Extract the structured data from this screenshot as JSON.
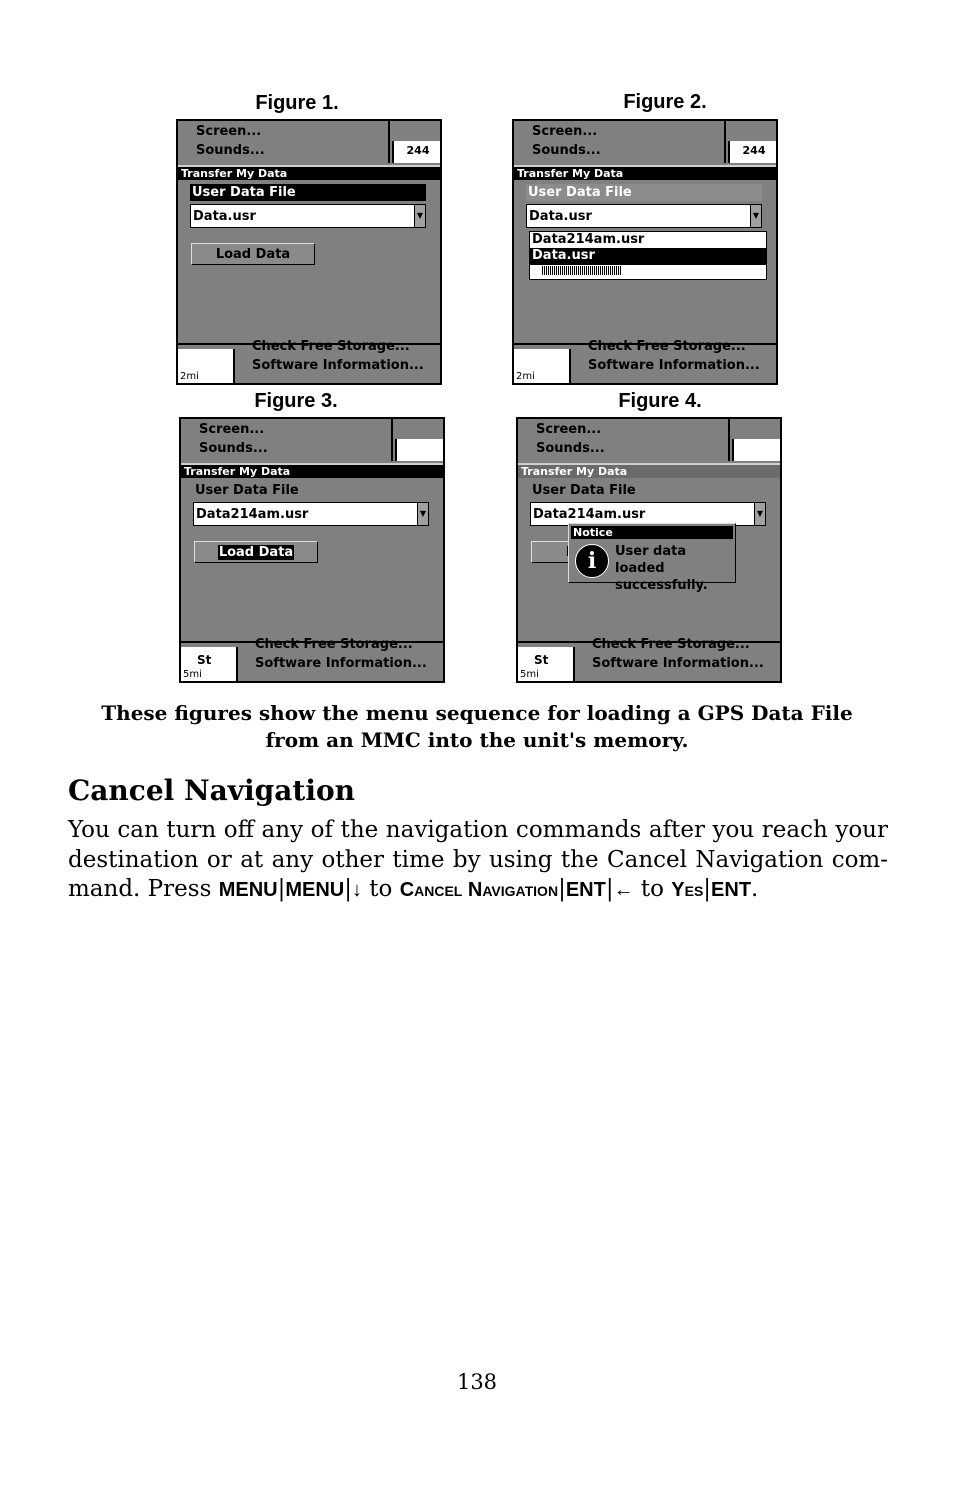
{
  "figures": [
    {
      "label": "Figure 1.",
      "menu": [
        "Screen...",
        "Sounds..."
      ],
      "map_badge": "244",
      "title": "Transfer My Data",
      "header": "User Data File",
      "dropdown": "Data.usr",
      "button": "Load Data",
      "bottom": [
        "Check Free Storage...",
        "Software Information..."
      ],
      "scale": "2mi"
    },
    {
      "label": "Figure 2.",
      "menu": [
        "Screen...",
        "Sounds..."
      ],
      "map_badge": "244",
      "title": "Transfer My Data",
      "header": "User Data File",
      "dropdown": "Data.usr",
      "list": [
        "Data214am.usr",
        "Data.usr"
      ],
      "bottom": [
        "Check Free Storage...",
        "Software Information..."
      ],
      "scale": "2mi"
    },
    {
      "label": "Figure 3.",
      "menu": [
        "Screen...",
        "Sounds..."
      ],
      "title": "Transfer My Data",
      "header": "User Data File",
      "dropdown": "Data214am.usr",
      "button": "Load Data",
      "bottom": [
        "Check Free Storage...",
        "Software Information..."
      ],
      "scale": "5mi",
      "map_text": "St"
    },
    {
      "label": "Figure 4.",
      "menu": [
        "Screen...",
        "Sounds..."
      ],
      "title": "Transfer My Data",
      "header": "User Data File",
      "dropdown": "Data214am.usr",
      "button_partial": "L",
      "notice_title": "Notice",
      "notice_msg": [
        "User data loaded",
        "successfully."
      ],
      "bottom": [
        "Check Free Storage...",
        "Software Information..."
      ],
      "scale": "5mi",
      "map_text": "St"
    }
  ],
  "caption": [
    "These figures show the menu sequence for loading a GPS Data File",
    "from an MMC into the unit's memory."
  ],
  "section": {
    "heading": "Cancel Navigation",
    "text1": "You can turn off any of the navigation commands after you reach your destination or at any other time by using the Cancel Navigation com-mand. Press ",
    "keys": {
      "k1": "MENU",
      "k2": "MENU",
      "down": "↓",
      "to1": " to ",
      "cn": "Cancel Navigation",
      "ent": "ENT",
      "left": "←",
      "to2": " to ",
      "yes": "Yes",
      "ent2": "ENT",
      "sep": "|",
      "end": "."
    }
  },
  "page_number": "138"
}
